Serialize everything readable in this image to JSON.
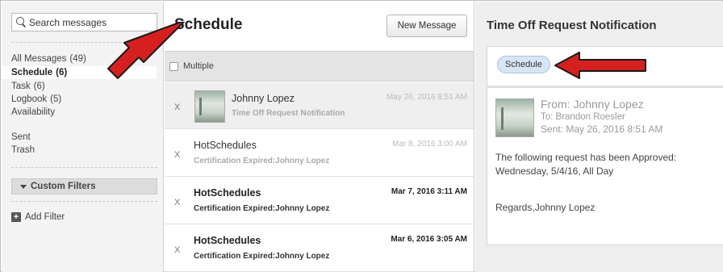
{
  "sidebar": {
    "search_placeholder": "Search messages",
    "folders": [
      {
        "label": "All Messages",
        "count": "(49)"
      },
      {
        "label": "Schedule",
        "count": "(6)",
        "active": true
      },
      {
        "label": "Task",
        "count": "(6)"
      },
      {
        "label": "Logbook",
        "count": "(5)"
      },
      {
        "label": "Availability",
        "count": ""
      }
    ],
    "extras": [
      "Sent",
      "Trash"
    ],
    "custom_filters_label": "Custom Filters",
    "add_filter_label": "Add Filter"
  },
  "list": {
    "title": "Schedule",
    "new_message_label": "New Message",
    "multiple_label": "Multiple",
    "messages": [
      {
        "x": "X",
        "sender": "Johnny Lopez",
        "subject": "Time Off Request Notification",
        "date": "May 26, 2016 8:51 AM",
        "has_thumb": true,
        "unread": false,
        "selected": true
      },
      {
        "x": "X",
        "sender": "HotSchedules",
        "subject": "Certification Expired:Johnny Lopez",
        "date": "Mar 8, 2016 3:00 AM",
        "has_thumb": false,
        "unread": false
      },
      {
        "x": "X",
        "sender": "HotSchedules",
        "subject": "Certification Expired:Johnny Lopez",
        "date": "Mar 7, 2016 3:11 AM",
        "has_thumb": false,
        "unread": true
      },
      {
        "x": "X",
        "sender": "HotSchedules",
        "subject": "Certification Expired:Johnny Lopez",
        "date": "Mar 6, 2016 3:05 AM",
        "has_thumb": false,
        "unread": true
      }
    ]
  },
  "detail": {
    "title": "Time Off Request Notification",
    "tag": "Schedule",
    "from": "From: Johnny Lopez",
    "to": "To: Brandon Roesler",
    "sent": "Sent: May 26, 2016 8:51 AM",
    "body_line1": "The following request has been Approved:",
    "body_line2": "Wednesday, 5/4/16, All Day",
    "regards": "Regards,Johnny Lopez"
  },
  "colors": {
    "annotation_arrow": "#d62020",
    "tag_fill": "#d7e6f6"
  }
}
